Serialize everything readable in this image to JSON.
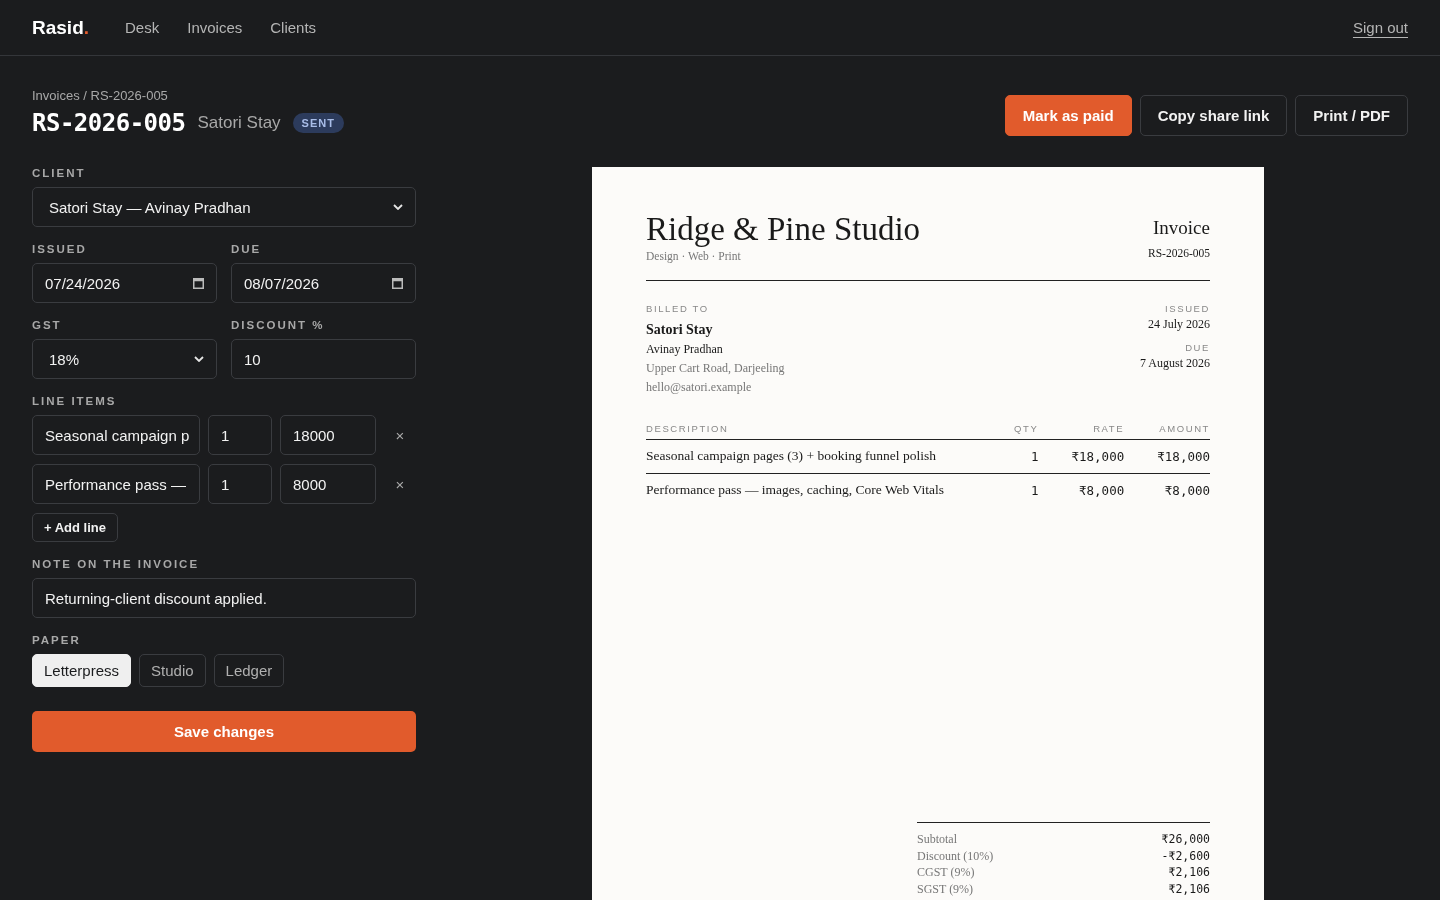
{
  "nav": {
    "logo": {
      "name": "Rasid",
      "mark": "."
    },
    "links": [
      {
        "label": "Desk"
      },
      {
        "label": "Invoices"
      },
      {
        "label": "Clients"
      }
    ],
    "sign_out": "Sign out"
  },
  "header": {
    "breadcrumb": "Invoices / RS-2026-005",
    "title": "RS-2026-005",
    "client": "Satori Stay",
    "status": "SENT"
  },
  "actions": [
    {
      "label": "Mark as paid",
      "kind": "primary"
    },
    {
      "label": "Copy share link",
      "kind": "outline"
    },
    {
      "label": "Print / PDF",
      "kind": "outline"
    }
  ],
  "form": {
    "client": {
      "label": "CLIENT",
      "value": "Satori Stay — Avinay Pradhan"
    },
    "issued": {
      "label": "ISSUED",
      "value": "07/24/2026"
    },
    "due": {
      "label": "DUE",
      "value": "08/07/2026"
    },
    "gst": {
      "label": "GST",
      "value": "18%"
    },
    "discount": {
      "label": "DISCOUNT %",
      "value": "10"
    },
    "line_items_label": "LINE ITEMS",
    "line_items": [
      {
        "description": "Seasonal campaign p",
        "qty": "1",
        "rate": "18000",
        "remove": "×"
      },
      {
        "description": "Performance pass —",
        "qty": "1",
        "rate": "8000",
        "remove": "×"
      }
    ],
    "add_line": "+ Add line",
    "note": {
      "label": "NOTE ON THE INVOICE",
      "value": "Returning-client discount applied."
    },
    "paper": {
      "label": "PAPER",
      "options": [
        {
          "label": "Letterpress",
          "selected": true
        },
        {
          "label": "Studio",
          "selected": false
        },
        {
          "label": "Ledger",
          "selected": false
        }
      ]
    },
    "save": "Save changes"
  },
  "invoice": {
    "studio": "Ridge & Pine Studio",
    "tagline": "Design · Web · Print",
    "doc_title": "Invoice",
    "number": "RS-2026-005",
    "billed_to_label": "BILLED TO",
    "client_name": "Satori Stay",
    "contact": "Avinay Pradhan",
    "address": "Upper Cart Road, Darjeeling",
    "email": "hello@satori.example",
    "issued_label": "ISSUED",
    "issued": "24 July 2026",
    "due_label": "DUE",
    "due": "7 August 2026",
    "columns": [
      "DESCRIPTION",
      "QTY",
      "RATE",
      "AMOUNT"
    ],
    "rows": [
      {
        "description": "Seasonal campaign pages (3) + booking funnel polish",
        "qty": "1",
        "rate": "₹18,000",
        "amount": "₹18,000"
      },
      {
        "description": "Performance pass — images, caching, Core Web Vitals",
        "qty": "1",
        "rate": "₹8,000",
        "amount": "₹8,000"
      }
    ],
    "totals": [
      {
        "label": "Subtotal",
        "value": "₹26,000"
      },
      {
        "label": "Discount (10%)",
        "value": "-₹2,600"
      },
      {
        "label": "CGST (9%)",
        "value": "₹2,106"
      },
      {
        "label": "SGST (9%)",
        "value": "₹2,106"
      }
    ]
  }
}
